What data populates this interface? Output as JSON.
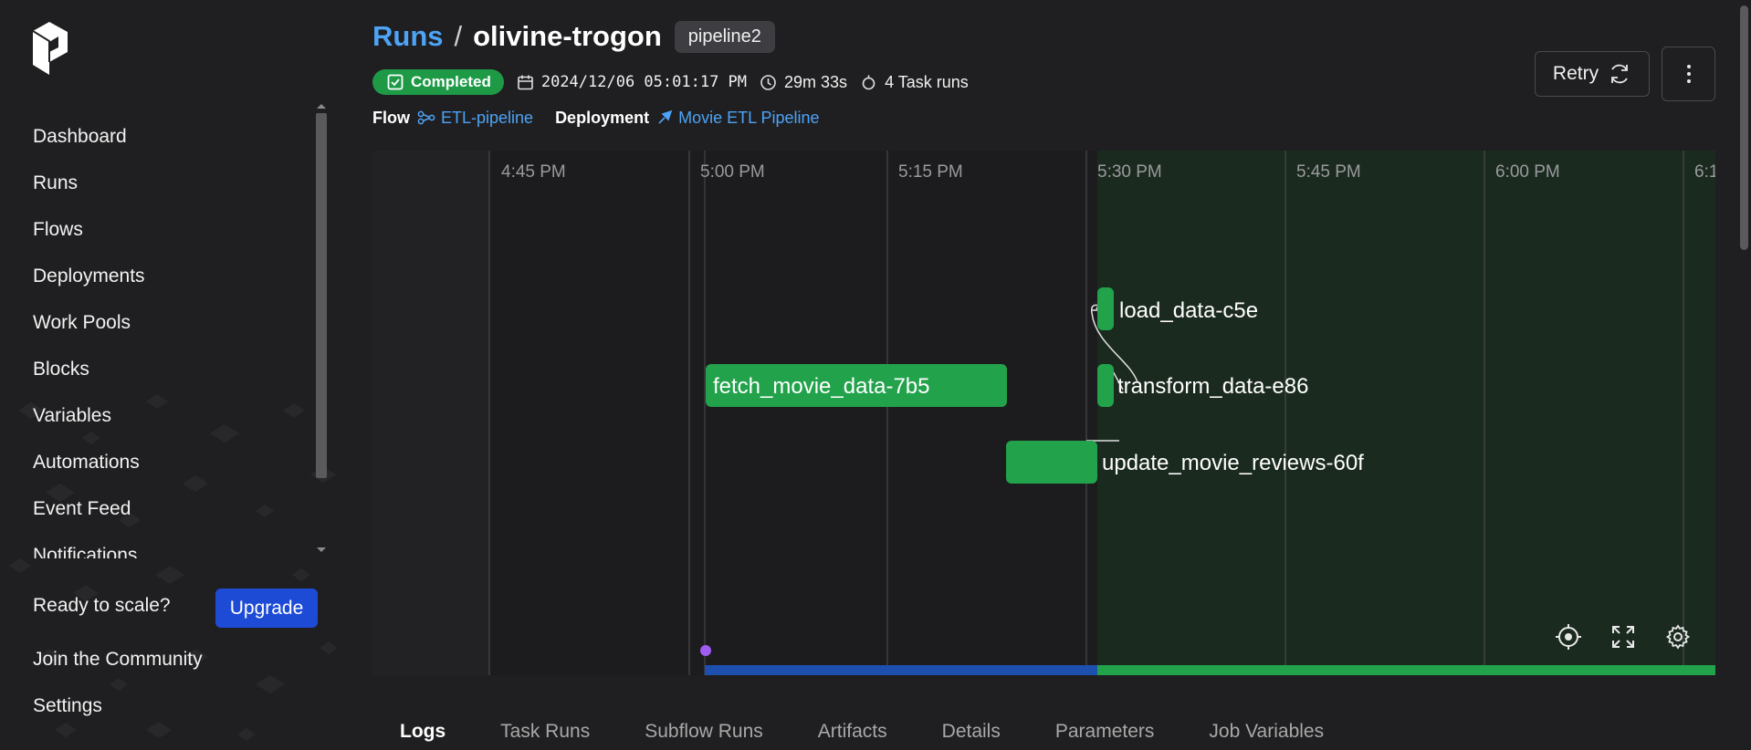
{
  "sidebar": {
    "items": [
      {
        "label": "Dashboard"
      },
      {
        "label": "Runs"
      },
      {
        "label": "Flows"
      },
      {
        "label": "Deployments"
      },
      {
        "label": "Work Pools"
      },
      {
        "label": "Blocks"
      },
      {
        "label": "Variables"
      },
      {
        "label": "Automations"
      },
      {
        "label": "Event Feed"
      },
      {
        "label": "Notifications"
      }
    ],
    "ready_text": "Ready to scale?",
    "upgrade_label": "Upgrade",
    "community_label": "Join the Community",
    "settings_label": "Settings"
  },
  "header": {
    "breadcrumb_root": "Runs",
    "breadcrumb_sep": "/",
    "run_name": "olivine-trogon",
    "tag": "pipeline2",
    "status": "Completed",
    "start_time": "2024/12/06 05:01:17 PM",
    "duration": "29m 33s",
    "task_runs": "4 Task runs",
    "flow_label": "Flow",
    "flow_name": "ETL-pipeline",
    "deployment_label": "Deployment",
    "deployment_name": "Movie ETL Pipeline",
    "retry_label": "Retry"
  },
  "timeline": {
    "time_labels": [
      "4:45 PM",
      "5:00 PM",
      "5:15 PM",
      "5:30 PM",
      "5:45 PM",
      "6:00 PM",
      "6:1"
    ],
    "tasks": [
      {
        "name": "load_data-c5e"
      },
      {
        "name": "fetch_movie_data-7b5"
      },
      {
        "name": "transform_data-e86"
      },
      {
        "name": "update_movie_reviews-60f"
      }
    ],
    "colors": {
      "completed": "#22a24b",
      "running_band": "#1d4fae",
      "future_bg": "#1b2a1f",
      "event_dot": "#a05cf0"
    }
  },
  "tabs": [
    {
      "label": "Logs"
    },
    {
      "label": "Task Runs"
    },
    {
      "label": "Subflow Runs"
    },
    {
      "label": "Artifacts"
    },
    {
      "label": "Details"
    },
    {
      "label": "Parameters"
    },
    {
      "label": "Job Variables"
    }
  ]
}
